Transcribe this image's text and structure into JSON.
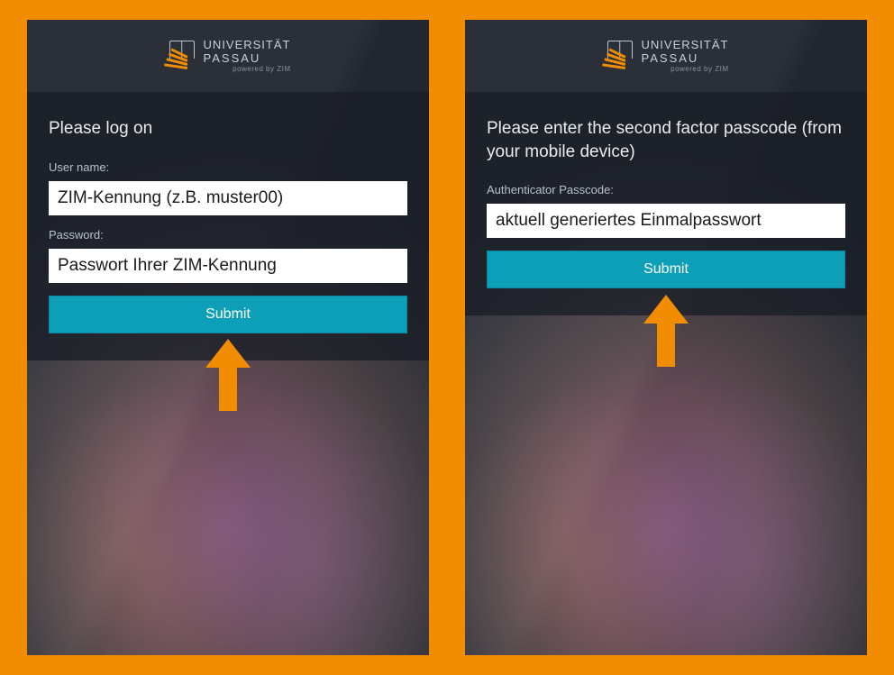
{
  "logo": {
    "line1": "UNIVERSITÄT",
    "line2": "PASSAU",
    "sub": "powered by ZIM"
  },
  "left": {
    "heading": "Please log on",
    "username_label": "User name:",
    "username_value": "ZIM-Kennung (z.B. muster00)",
    "password_label": "Password:",
    "password_value": "Passwort Ihrer ZIM-Kennung",
    "submit": "Submit"
  },
  "right": {
    "heading": "Please enter the second factor passcode (from your mobile device)",
    "passcode_label": "Authenticator Passcode:",
    "passcode_value": "aktuell generiertes Einmalpasswort",
    "submit": "Submit"
  },
  "colors": {
    "accent": "#f28c00",
    "button": "#0e9fb8"
  }
}
